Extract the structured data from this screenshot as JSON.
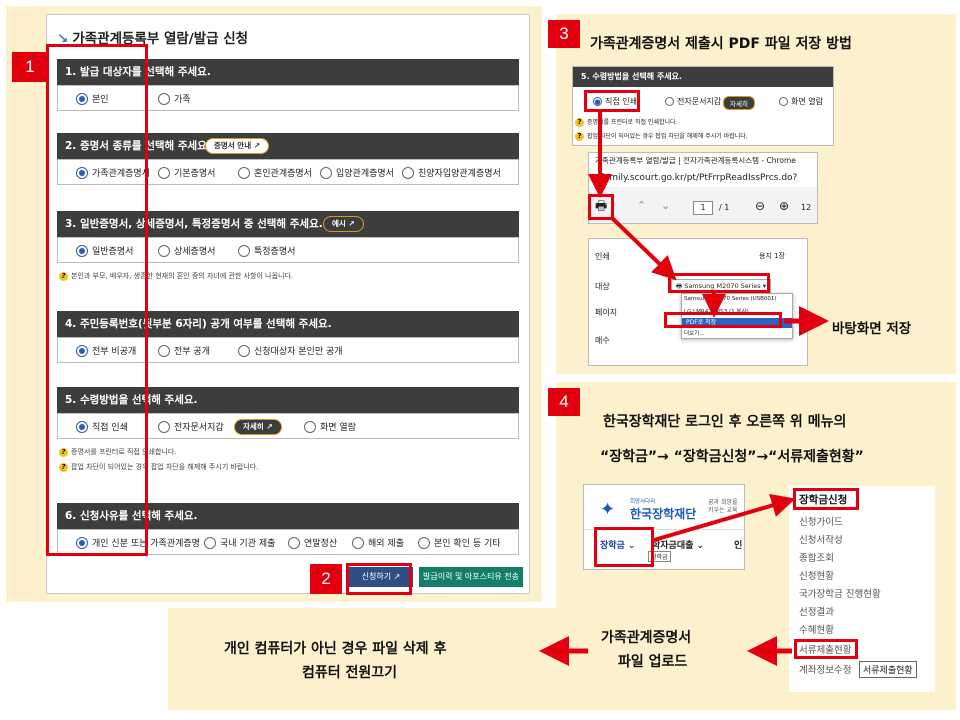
{
  "form": {
    "title": "가족관계등록부 열람/발급 신청",
    "sections": [
      {
        "header": "1. 발급 대상자를 선택해 주세요.",
        "options": [
          "본인",
          "가족"
        ],
        "selected": 0
      },
      {
        "header": "2. 증명서 종류를 선택해 주세요.",
        "button": "증명서 안내",
        "options": [
          "가족관계증명서",
          "기본증명서",
          "혼인관계증명서",
          "입양관계증명서",
          "친양자입양관계증명서"
        ],
        "selected": 0
      },
      {
        "header": "3. 일반증명서, 상세증명서, 특정증명서 중 선택해 주세요.",
        "button": "예시",
        "options": [
          "일반증명서",
          "상세증명서",
          "특정증명서"
        ],
        "selected": 0,
        "note": "본인과 부모, 배우자, 생존한 현재의 혼인 중의 자녀에 관한 사항이 나옵니다."
      },
      {
        "header": "4. 주민등록번호(뒷부분 6자리) 공개 여부를 선택해 주세요.",
        "options": [
          "전부 비공개",
          "전부 공개",
          "신청대상자 본인만 공개"
        ],
        "selected": 0
      },
      {
        "header": "5. 수령방법을 선택해 주세요.",
        "button": "자세히",
        "options": [
          "직접 인쇄",
          "전자문서지갑",
          "화면 열람"
        ],
        "selected": 0,
        "notes": [
          "증명서를 프린터로 직접 인쇄합니다.",
          "팝업 차단이 되어있는 경우 팝업 차단을 해제해 주시기 바랍니다."
        ]
      },
      {
        "header": "6. 신청사유를 선택해 주세요.",
        "options": [
          "개인 신분 또는 가족관계증명",
          "국내 기관 제출",
          "연말정산",
          "해외 제출",
          "본인 확인 등 기타"
        ],
        "selected": 0
      }
    ],
    "submit_label": "신청하기",
    "history_label": "발급이력 및 아포스티유 전송"
  },
  "steps": {
    "one": "1",
    "two": "2",
    "three": "3",
    "four": "4"
  },
  "step3": {
    "title": "가족관계증명서 제출시 PDF 파일 저장 방법",
    "shot1": {
      "header": "5. 수령방법을 선택해 주세요.",
      "options": [
        "직접 인쇄",
        "전자문서지갑",
        "화면 열람"
      ],
      "button": "자세히",
      "notes": [
        "증명서를 프린터로 직접 인쇄합니다.",
        "팝업 차단이 되어있는 경우 팝업 차단을 해제해 주시기 바랍니다."
      ]
    },
    "shot2": {
      "window_title": "가족관계등록부 열람/발급 | 전자가족관계등록시스템 - Chrome",
      "url": "efamily.scourt.go.kr/pt/PtFrrpReadIssPrcs.do?",
      "page_current": "1",
      "page_total": "/ 1",
      "zoom": "12"
    },
    "shot3": {
      "print_label": "인쇄",
      "sheets": "용지 1장",
      "dest_label": "대상",
      "printer_selected": "Samsung M2070 Series",
      "page_label": "페이지",
      "copies_label": "매수",
      "dropdown": [
        "Samsung M2070 Series (USB001)",
        "LG LMR420 PS3 (1 복사)",
        "PDF로 저장",
        "더보기..."
      ],
      "dropdown_selected": 2
    },
    "save_note": "바탕화면 저장"
  },
  "step4": {
    "line1": "한국장학재단 로그인 후 오른쪽 위 메뉴의",
    "line2": "“장학금”→ “장학금신청”→“서류제출현황”",
    "logo_small": "희망사다리",
    "logo_text": "한국장학재단",
    "logo_side": "꿈과 희망을 키우는 교육",
    "nav": [
      "장학금",
      "학자금대출",
      "인"
    ],
    "nav_sub": "장학금",
    "menu": [
      "장학금신청",
      "신청가이드",
      "신청서작성",
      "종합조회",
      "신청현황",
      "국가장학금 진행현황",
      "선정결과",
      "수혜현황",
      "서류제출현황",
      "계좌정보수정"
    ],
    "tooltip": "서류제출현황"
  },
  "upload": {
    "line1": "가족관계증명서",
    "line2": "파일 업로드"
  },
  "final": {
    "line1": "개인 컴퓨터가 아닌 경우 파일 삭제 후",
    "line2": "컴퓨터 전원끄기"
  },
  "colors": {
    "accent_red": "#e2000f",
    "panel_bg": "#fdf0cc",
    "header_dark": "#3d3d3d",
    "select_blue": "#2f5ca8",
    "submit_blue": "#2f4e86",
    "history_green": "#137f6b"
  }
}
